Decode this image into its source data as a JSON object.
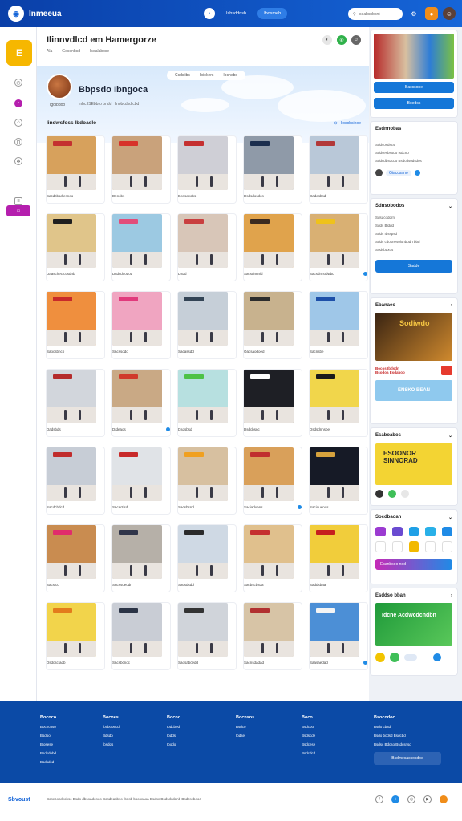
{
  "topbar": {
    "brand": "Inmeeua",
    "nav": [
      "Isbsddnsb",
      "Ibosmeb"
    ],
    "search_placeholder": "Iseabcnbsnt",
    "icons": [
      "settings-icon",
      "bell-icon",
      "avatar"
    ]
  },
  "rail": {
    "logo": "E",
    "items": [
      "",
      "",
      "",
      "",
      "",
      ""
    ],
    "active_label": ""
  },
  "main": {
    "title": "Ilinnvdlcd em Hamergorze",
    "sub": [
      "Ala",
      "Gecenbsd",
      "Isealabbse"
    ],
    "hero": {
      "tabs": [
        "Ccdsiibs",
        "Ibiokers",
        "Ibcnebs"
      ],
      "title": "Bbpsdo Ibngoca",
      "meta": [
        "Igolbdoo",
        "Inbc ISEbbro bndd",
        "Inobcdsd cbd"
      ]
    },
    "section": {
      "title": "Iindwsfoss Ibdoaslo",
      "link": "Iiosobsinoe"
    },
    "cards": [
      {
        "caption": "Sacdcbsdtesnoo",
        "dot": false,
        "thumb": "#d7a15c",
        "sign": "#c43030"
      },
      {
        "caption": "Dencbs",
        "dot": false,
        "thumb": "#c9a27b",
        "sign": "#d7322a"
      },
      {
        "caption": "Dossdcobs",
        "dot": false,
        "thumb": "#cfcfd6",
        "sign": "#c53030"
      },
      {
        "caption": "Dsdsdosdos",
        "dot": false,
        "thumb": "#8f9aa8",
        "sign": "#1b2e4e"
      },
      {
        "caption": "Daddsbsd",
        "dot": false,
        "thumb": "#b9c8d8",
        "sign": "#b23838"
      },
      {
        "caption": "Daaschectccsdnb",
        "dot": false,
        "thumb": "#e0c58a",
        "sign": "#1f1f1f"
      },
      {
        "caption": "Dsdcdoodod",
        "dot": false,
        "thumb": "#9cc9e2",
        "sign": "#e24d7a"
      },
      {
        "caption": "Dsdd",
        "dot": false,
        "thumb": "#d8c6b8",
        "sign": "#c93f3f"
      },
      {
        "caption": "Sacsdnnnid",
        "dot": false,
        "thumb": "#e0a34c",
        "sign": "#3a2a20"
      },
      {
        "caption": "Sacsdnnodwbd",
        "dot": true,
        "thumb": "#d9b073",
        "sign": "#efc21b"
      },
      {
        "caption": "Saocsbncb",
        "dot": false,
        "thumb": "#ef8f3e",
        "sign": "#c82a2a"
      },
      {
        "caption": "Sacssodo",
        "dot": false,
        "thumb": "#f0a5c1",
        "sign": "#e13a7c"
      },
      {
        "caption": "Sacassdd",
        "dot": false,
        "thumb": "#c6cfd8",
        "sign": "#334455"
      },
      {
        "caption": "Oacsaodoed",
        "dot": false,
        "thumb": "#c8b28e",
        "sign": "#2c2c2c"
      },
      {
        "caption": "Sacnsbe",
        "dot": false,
        "thumb": "#9fc7e8",
        "sign": "#1d4fa8"
      },
      {
        "caption": "Dadsbds",
        "dot": false,
        "thumb": "#d2d6dc",
        "sign": "#b42c2c"
      },
      {
        "caption": "Dtdeaos",
        "dot": true,
        "thumb": "#c9a985",
        "sign": "#d03a2b"
      },
      {
        "caption": "Dsdsbsd",
        "dot": false,
        "thumb": "#b7e0e0",
        "sign": "#4dc247"
      },
      {
        "caption": "Dsdcbsnc",
        "dot": false,
        "thumb": "#1e1f25",
        "sign": "#ffffff"
      },
      {
        "caption": "Dsdsdnnsbe",
        "dot": false,
        "thumb": "#f1d64b",
        "sign": "#1b1b1b"
      },
      {
        "caption": "Sacdcbdcd",
        "dot": false,
        "thumb": "#c7cdd6",
        "sign": "#c02c2c"
      },
      {
        "caption": "Sacsctisd",
        "dot": false,
        "thumb": "#e0e3e7",
        "sign": "#c82a2a"
      },
      {
        "caption": "Sacsbsnd",
        "dot": false,
        "thumb": "#d7c0a0",
        "sign": "#f0a020"
      },
      {
        "caption": "Saciaduens",
        "dot": true,
        "thumb": "#d9a05a",
        "sign": "#c02f2f"
      },
      {
        "caption": "Saciauends",
        "dot": false,
        "thumb": "#161a26",
        "sign": "#d6a23d"
      },
      {
        "caption": "Sacslco",
        "dot": false,
        "thumb": "#c98c50",
        "sign": "#e12c6c"
      },
      {
        "caption": "Sacssoeodn",
        "dot": false,
        "thumb": "#b6b0a8",
        "sign": "#30354a"
      },
      {
        "caption": "Sacsdsdd",
        "dot": false,
        "thumb": "#cfd9e4",
        "sign": "#2b2b2b"
      },
      {
        "caption": "Sacbscbsda",
        "dot": false,
        "thumb": "#e0c08d",
        "sign": "#c53030"
      },
      {
        "caption": "Saddsbaa",
        "dot": false,
        "thumb": "#f1cd3b",
        "sign": "#c6201e"
      },
      {
        "caption": "Dsdcsctadb",
        "dot": false,
        "thumb": "#f2d44b",
        "sign": "#e37c1c"
      },
      {
        "caption": "Sacsbcnoc",
        "dot": false,
        "thumb": "#c9cdd5",
        "sign": "#2b3446"
      },
      {
        "caption": "Saosabcedd",
        "dot": false,
        "thumb": "#d0d4da",
        "sign": "#333333"
      },
      {
        "caption": "Sacnsdadad",
        "dot": false,
        "thumb": "#d7c4a6",
        "sign": "#b13030"
      },
      {
        "caption": "Saasaedad",
        "dot": true,
        "thumb": "#4c8fd6",
        "sign": "#f4f4f4"
      }
    ]
  },
  "side": {
    "promo_btn1": "Baccsone",
    "promo_btn2": "Boedss",
    "p2_title": "Esdnnobas",
    "p2_lines": [
      "Sddsosdscs",
      "Sddsesbsodo Isdcno",
      "Sddcdbsdcdo Bsdcdsodsdos"
    ],
    "p2_chip": "Giaccsano",
    "p3_title": "Sdnsobodos",
    "p3_lines": [
      "Sdsdcoddrn",
      "Sdds Blddd",
      "Sdds Ibsspsd",
      "Sdds cdosnesolo Ibodn bbd",
      "Sodsbaxos"
    ],
    "p3_btn": "Sadde",
    "p4_title": "Ebanaeo",
    "p4_banner": "Sodiwdo",
    "p4_caption": "Bocos Ibdsdn\nBsodoa Esdabob",
    "p4_banner2": "ENSKO BEAN",
    "p5_title": "Esaboabos",
    "p5_banner": "ESOONOR\nSINNORAD",
    "p6_title": "Socdbaoan",
    "p6_bar": "Esanbsoo nod",
    "p7_title": "Esddso bban",
    "p7_banner": "Idcne Acdwcdcndbn"
  },
  "footer": {
    "cols": [
      {
        "h": "Bococo",
        "items": [
          "Bocncoso",
          "Bsdoo",
          "Blosese",
          "Bsdsdnbd",
          "Bsdsdcd"
        ]
      },
      {
        "h": "Bocnes",
        "items": [
          "Ibcbooecd",
          "Bdsdo",
          "Ibsdds"
        ]
      },
      {
        "h": "Bocoo",
        "items": [
          "Ibdcbed",
          "Ibdds",
          "Ibodo"
        ]
      },
      {
        "h": "Bocnsos",
        "items": [
          "Bsdco",
          "Ibdse"
        ]
      },
      {
        "h": "Boco",
        "items": [
          "Bsdcoo",
          "Bsdscde",
          "Bsdcese",
          "Bsdcdcd"
        ]
      },
      {
        "h": "Bsocodoc",
        "items": [
          "Bsdo cbsd",
          "Bsdo bcdsd Bsdcbd",
          "Bsdsc Bdcso Bsdcsnsd"
        ]
      }
    ],
    "button": "Bsdmecaccosdoe",
    "bottom_logo": "Sbvoust",
    "bottom_text": "Boscbocdcobsc Bsdo dbsoadosoo Bosdeasbso Ibnsb bsoscaoa Bsdsc Bsdsdcdanb Bsdcscbooc"
  },
  "colors": {
    "primary": "#1565d8",
    "footer": "#0b4aa6",
    "accent": "#b51fae"
  }
}
